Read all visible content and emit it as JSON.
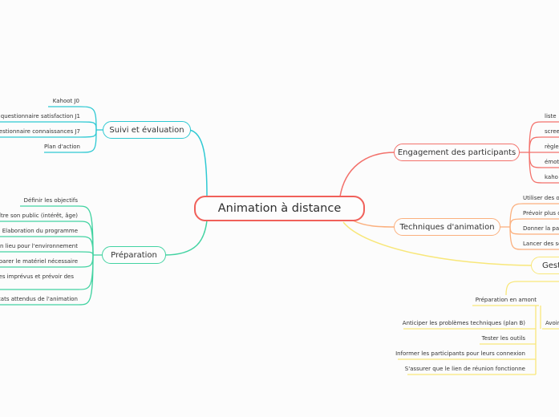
{
  "root": {
    "label": "Animation à distance",
    "color": "#f0605a"
  },
  "branches": {
    "suivi": {
      "label": "Suivi et évaluation",
      "color": "#2ec9d3",
      "items": [
        "Kahoot J0",
        "questionnaire satisfaction J1",
        "estionnaire connaissances J7",
        "Plan d'action"
      ]
    },
    "preparation": {
      "label": "Préparation",
      "color": "#43d3a2",
      "items": [
        "Définir les objectifs",
        "aître son public (intérêt, âge)",
        "Elaboration du programme",
        "un lieu pour l'environnement",
        "parer le matériel nécessaire",
        "les imprévus et prévoir des",
        "ltats attendus de l'animation"
      ]
    },
    "engagement": {
      "label": "Engagement des participants",
      "color": "#f3716b",
      "items": [
        "liste",
        "scree",
        "règle",
        "émot",
        "kaho"
      ]
    },
    "techniques": {
      "label": "Techniques d'animation",
      "color": "#fbb07e",
      "items": [
        "Utiliser des o",
        "Prévoir plus d",
        "Donner la pa",
        "Lancer des sé"
      ]
    },
    "gestion": {
      "label": "Gesti",
      "color": "#f8e77a",
      "sub": {
        "label": "Préparation en amont",
        "items": [
          "Anticiper les problèmes techniques (plan B)",
          "Tester les outils",
          "Informer les participants pour leurs connexion",
          "S'assurer que le lien de réunion fonctionne"
        ]
      },
      "sub2": {
        "label": "Avoir"
      }
    }
  }
}
